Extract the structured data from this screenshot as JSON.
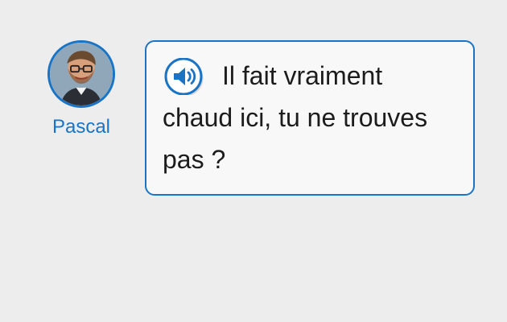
{
  "speaker": {
    "name": "Pascal"
  },
  "message": {
    "text": "Il fait vraiment chaud ici, tu ne trouves pas ?"
  },
  "icons": {
    "audio": "speaker-icon",
    "avatar": "avatar"
  },
  "colors": {
    "accent": "#1a74c6",
    "background": "#ededed",
    "bubble_background": "#f8f8f8",
    "text": "#1c1c1c"
  }
}
